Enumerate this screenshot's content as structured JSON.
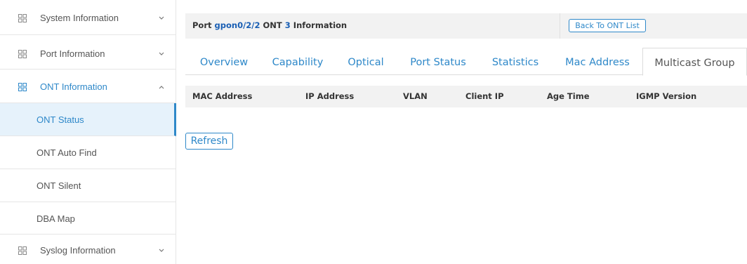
{
  "sidebar": {
    "menus": [
      {
        "label": "System Information",
        "icon": "grid-icon",
        "chevron": "chevron-down"
      },
      {
        "label": "Port Information",
        "icon": "grid-icon",
        "chevron": "chevron-down"
      },
      {
        "label": "ONT Information",
        "icon": "grid-icon",
        "chevron": "chevron-up"
      },
      {
        "label": "Syslog Information",
        "icon": "grid-icon",
        "chevron": "chevron-down"
      }
    ],
    "submenu": [
      {
        "label": "ONT Status",
        "selected": true
      },
      {
        "label": "ONT Auto Find"
      },
      {
        "label": "ONT Silent"
      },
      {
        "label": "DBA Map"
      }
    ]
  },
  "header": {
    "prefix": "Port",
    "port": "gpon0/2/2",
    "ont_label": "ONT",
    "ont_id": "3",
    "suffix": "Information",
    "back_button": "Back To ONT List"
  },
  "tabs": [
    "Overview",
    "Capability",
    "Optical",
    "Port Status",
    "Statistics",
    "Mac Address",
    "Multicast Group"
  ],
  "active_tab": "Multicast Group",
  "table": {
    "columns": [
      "MAC Address",
      "IP Address",
      "VLAN",
      "Client IP",
      "Age Time",
      "IGMP Version"
    ],
    "rows": []
  },
  "refresh_button": "Refresh",
  "colors": {
    "accent": "#2e88c9",
    "link": "#1a5fb4",
    "header_bg": "#f2f2f2",
    "selected_bg": "#e6f2fb"
  }
}
